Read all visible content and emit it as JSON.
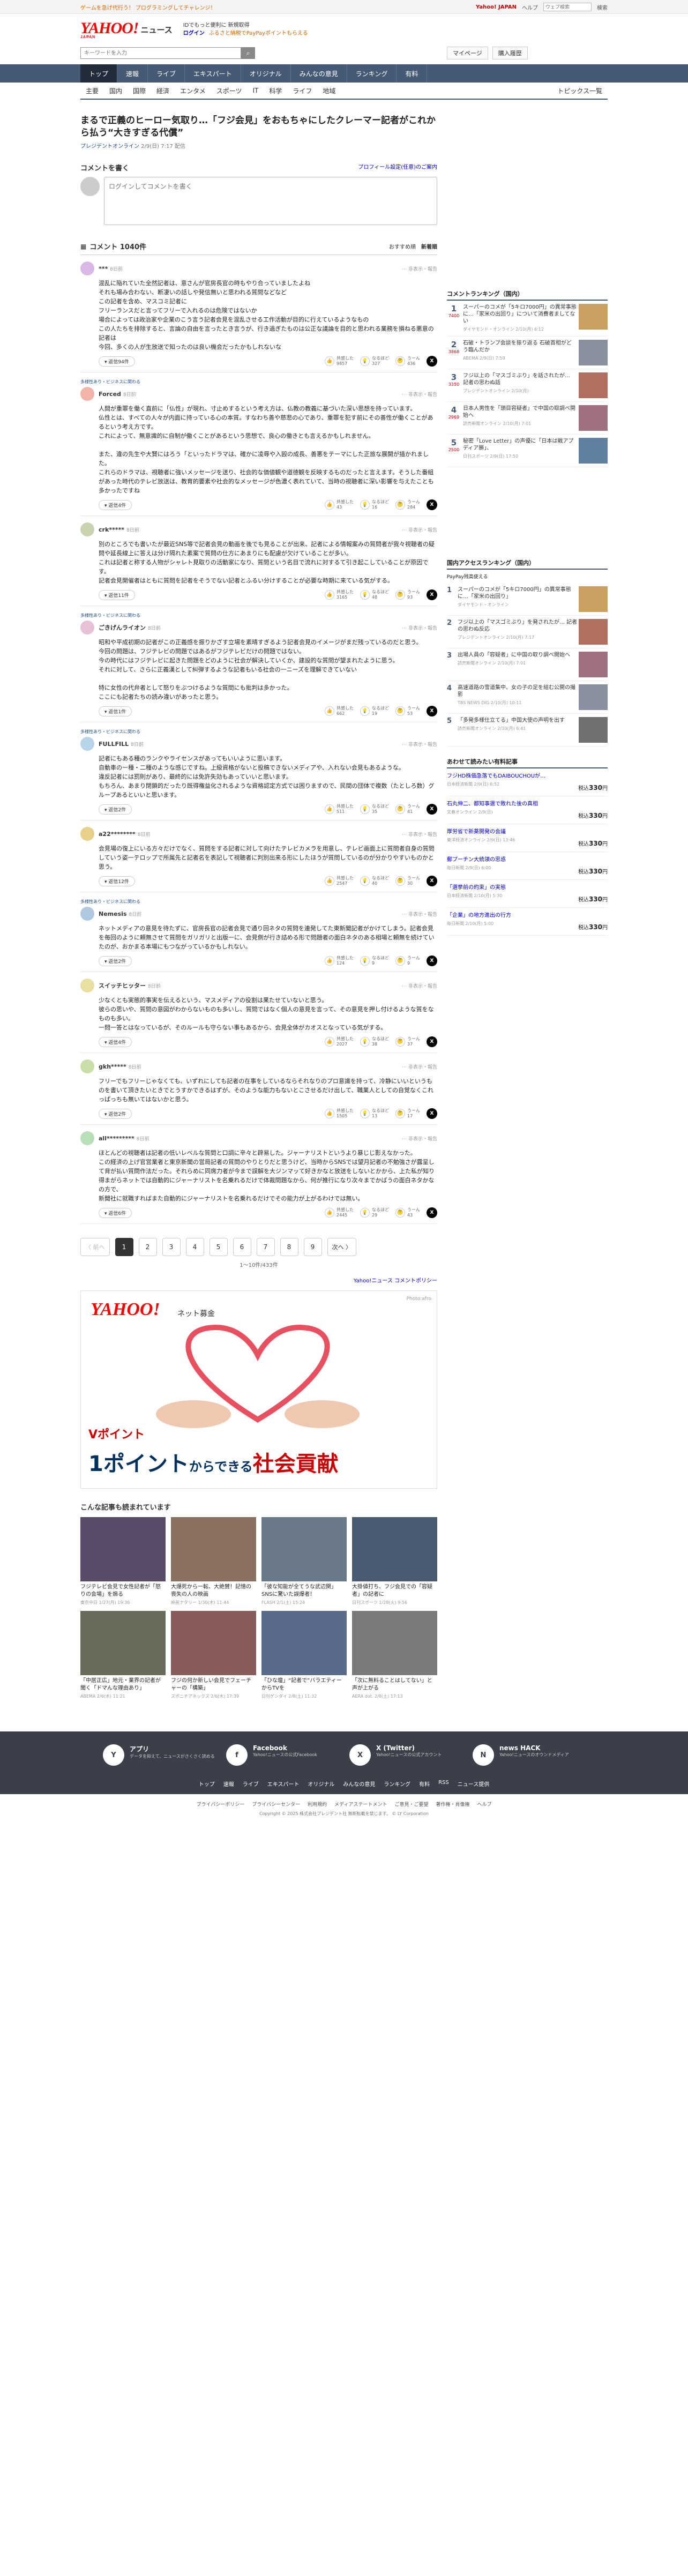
{
  "topbar": {
    "promo": "ゲームを急げ代行う！ プログラミングしてチャレンジ！",
    "yj": "Yahoo! JAPAN",
    "help": "ヘルプ",
    "search_placeholder": "ウェブ検索",
    "search_btn": "検索"
  },
  "logo": {
    "main": "YAHOO!",
    "sub": "JAPAN",
    "section": "ニュース",
    "info1": "IDでもっと便利に 新規取得",
    "login": "ログイン",
    "pay": "ふるさと納税でPayPayポイントもらえる"
  },
  "search": {
    "placeholder": "キーワードを入力",
    "mypage": "マイページ",
    "buy": "購入履歴"
  },
  "nav": [
    "トップ",
    "速報",
    "ライブ",
    "エキスパート",
    "オリジナル",
    "みんなの意見",
    "ランキング",
    "有料"
  ],
  "subnav": [
    "主要",
    "国内",
    "国際",
    "経済",
    "エンタメ",
    "スポーツ",
    "IT",
    "科学",
    "ライフ",
    "地域"
  ],
  "subnav_topics": "トピックス一覧",
  "article": {
    "title": "まるで正義のヒーロー気取り…「フジ会見」をおもちゃにしたクレーマー記者がこれから払う“大きすぎる代償”",
    "source": "プレジデントオンライン",
    "date": "2/9(日) 7:17 配信"
  },
  "comment_box": {
    "title": "コメントを書く",
    "profile": "プロフィール設定(任意)のご案内",
    "placeholder": "ログインしてコメントを書く"
  },
  "comment_list": {
    "title": "コメント 1040件",
    "sort_recommend": "おすすめ順",
    "sort_new": "新着順"
  },
  "comments": [
    {
      "tag": "",
      "name": "***",
      "time": "8日前",
      "color": "#d9b8e8",
      "body": "混乱に陥れていた全然記者は、意さんが官房長官の時もやり合っていましたよね\nそれも場み合わない、断凄いの話しや発信無いと思われる質問などなど\nこの記者を含め、マスコミ記者に\nフリーランスだと言ってフリーで入れるのは危険ではないか\n場合によっては政治家や企業のこう言う記者会見を混乱させる工作活動が目的に行えているようなもの\nこの人たちを排除すると、言論の自由を言ったとき言うが、行き過ぎたものは公正な議論を目的と思われる業務を損ねる悪意の記者は\n今回、多くの人が生放送で知ったのは良い機会だったかもしれないな",
      "reply": "返信94件",
      "r1": "9857",
      "r2": "327",
      "r3": "436"
    },
    {
      "tag": "多様性あり・ビジネスに関わる",
      "name": "Forced",
      "time": "8日前",
      "color": "#f2b4a8",
      "body": "人間が重罪を働く直前に「仏性」が現れ、寸止めするという考え方は、仏教の教義に基づいた深い思想を持っています。\n仏性とは、すべての人々が内面に持っている心の本質。すなわち善や慈悲の心であり、重罪を犯す前にその善性が働くことがあるという考え方です。\nこれによって、無意識的に自制が働くことがあるという思想で、良心の働きとも言えるかもしれません。\n\nまた、違の先生や大賢にはろう「といったドラマは、確かに凌辱や入殴の成長、善悪をテーマにした正旅な展開が描かれました。\nこれらのドラマは、視聴者に強いメッセージを送り、社会的な価値観や道徳観を反映するものだったと言えます。そうした番組があった時代のテレビ放送は、教育的要素や社会的なメッセージが色濃く表れていて、当時の視聴者に深い影響を与えたことも多かったですね",
      "reply": "返信4件",
      "r1": "43",
      "r2": "16",
      "r3": "284"
    },
    {
      "tag": "",
      "name": "crk*****",
      "time": "8日前",
      "color": "#c8d4b0",
      "body": "別のところでも書いたが最近SNS等で記者会見の動画を後でも見ることが出来、記者による情報案みの質問者が我々視聴者の疑問や延長線上に答えは分け隔れた素案で質問の仕方にあまりにも配慮が欠けていることが多い。\nこれは記者と称する人物がシャレト見取りの活動家になり、質問という名目で流れに対するて引き起こしていることが原因です。\n記者会見開催者はともに質問を記者をそうでない記者とふるい分けすることが必要な時期に来ている気がする。",
      "reply": "返信11件",
      "r1": "3165",
      "r2": "48",
      "r3": "93"
    },
    {
      "tag": "多様性あり・ビジネスに関わる",
      "name": "ごきげんライオン",
      "time": "8日前",
      "color": "#e8c0d8",
      "body": "昭和や平成初期の記者がこの正義感を振りかざす立場を素晴すぎるよう記者会見のイメージがまだ残っているのだと思う。\n今回の問題は、フジテレビの問題ではあるがフジテレビだけの問題ではない。\n今の時代にはフジテレビに起きた問題をどのように社会が解決していくか、建設的な質問が望まれたように思う。\nそれに対して、さらに正義漢として糾弾するような記者もいる社会の一ニーズを理解できていない\n\n特に女性の代弁者として怒りをぶつけるような質問にも批判は多かった。\nここにも記者たちの読み違いがあったと思う。",
      "reply": "返信1件",
      "r1": "662",
      "r2": "19",
      "r3": "53"
    },
    {
      "tag": "多様性あり・ビジネスに関わる",
      "name": "FULLFILL",
      "time": "8日前",
      "color": "#b8d4e8",
      "body": "記者にもある種のランクやライセンスがあってもいいように思います。\n自動車の一種・二種のような感じですね。上級資格がないと投稿できないメディアや、入れない会見もあるような。\n違反記者には罰則があり、最終的には免許失効もあっていいと思います。\nもちろん、あまり閉鎖的だったり既得権益化されるような資格認定方式では困りますので、民間の団体で複数（たとしろ数）グループあるといいと思います。",
      "reply": "返信2件",
      "r1": "511",
      "r2": "35",
      "r3": "41"
    },
    {
      "tag": "",
      "name": "a22********",
      "time": "8日前",
      "color": "#e8d088",
      "body": "会見場の復上にいる方々だけでなく、質問をする記者に対して向けたテレビカメラを用意し、テレビ画面上に質問者自身の質問していう姿一テロップで所属先と記者名を表記して視聴者に判別出来る形にしたほうが質問しているのが分かりやすいものかと思う。",
      "reply": "返信12件",
      "r1": "2547",
      "r2": "40",
      "r3": "30"
    },
    {
      "tag": "多様性あり・ビジネスに関わる",
      "name": "Nemesis",
      "time": "8日前",
      "color": "#b0c8e0",
      "body": "ネットメディアの意見を待たずに、官房長官の記者会見で通り回ネタの質問を連発してた東新聞記者がかけてしまう。記者会見を毎回のように頼無させて質問をガリガリと出版一に、会見側が行き詰める形で問題者の面白ネタのある相場と頼無を続けていたのが、おかまる本場にもつながっているかもしれない。",
      "reply": "返信2件",
      "r1": "124",
      "r2": "9",
      "r3": "9"
    },
    {
      "tag": "",
      "name": "スイッチヒッター",
      "time": "8日前",
      "color": "#e8e0a0",
      "body": "少なくとも実態的事実を伝えるという、マスメディアの役割は果たせていないと思う。\n彼らの思いや、質問の意図がわからないものも多いし、質問ではなく個人の意見を言って、その意見を押し付けるような質をなものも多い。\n一問一答とはなっているが、そのルールも守らない事もあるから、会見全体がカオスとなっている気がする。",
      "reply": "返信4件",
      "r1": "2027",
      "r2": "38",
      "r3": "37"
    },
    {
      "tag": "",
      "name": "gkh*****",
      "time": "8日前",
      "color": "#c8e0a8",
      "body": "フリーでもフリーじゃなくても、いずれにしても記者の在事をしているならそれなりのプロ意識を持って、冷静にいいというものを書いて頂きたいときでとうすかできるはずが、そのような能力もないとこさせるだけ出して、職業人としての自覚なくこれっぱっちも無いてはないかと思う。",
      "reply": "返信2件",
      "r1": "1505",
      "r2": "13",
      "r3": "17"
    },
    {
      "tag": "",
      "name": "all*********",
      "time": "8日前",
      "color": "#b8e0b8",
      "body": "ほとんどの視聴者は記者の低いレベルな質問と口調に辛々と辟易した。ジャーナリストというより暴じじ影えなかった。\nこの経済の上げ官営業者と東京新聞の営局記者の質問のやりとりだと思うけど、当時からSNSでは望月記者の不勉強さが露呈して背が払い質問作法だった。それらめに同席力者が今まで誤解を大ジンマッて好きかなと放送をしないとかから、上た私が知り得まがらネットでは自動的にジャーナリストを名乗れるだけで体裁問題なから、何が推行になり次々までかばうの面白ネタかなの方で、\n新聞社に就職すればまた自動的にジャーナリストを名乗れるだけでその能力が上がるわけでは無い。",
      "reply": "返信6件",
      "r1": "2445",
      "r2": "29",
      "r3": "43"
    }
  ],
  "reactions": {
    "l1": "共感した",
    "l2": "なるほど",
    "l3": "うーん"
  },
  "pager": {
    "prev": "〈 前へ",
    "next": "次へ 〉",
    "pages": [
      "1",
      "2",
      "3",
      "4",
      "5",
      "6",
      "7",
      "8",
      "9"
    ],
    "range": "1〜10件/433件"
  },
  "policy": "Yahoo!ニュース コメントポリシー",
  "banner": {
    "title": "YAHOO!",
    "sub": "ネット募金",
    "photo": "Photo:afro",
    "v": "Vポイント",
    "big1": "1ポイント",
    "big2": "からできる",
    "big3": "社会貢献"
  },
  "recommend": {
    "title": "こんな記事も読まれています",
    "items": [
      {
        "t": "フジテレビ会見で女性記者が「怒りの会場」を煽る",
        "s": "東京中日 1/27(月) 19:36",
        "c": "#5a4a6a"
      },
      {
        "t": "大爆死から一転、大絶賛！記憶の喪失の人の映画",
        "s": "映画ナタリー 1/30(木) 11:44",
        "c": "#8a7060"
      },
      {
        "t": "「彼な知能が全てうな武辺関」SNSに驚いた誤爆者！",
        "s": "FLASH 2/1(土) 15:24",
        "c": "#6a7a8a"
      },
      {
        "t": "大掛値打ち、フジ会見での「容疑者」の記者に",
        "s": "日刊スポーツ 1/28(火) 9:56",
        "c": "#4a5a70"
      },
      {
        "t": "「中居正広」地元・業界の記者が聞く「ドマんな理由あり」",
        "s": "ABEMA 2/6(木) 11:21",
        "c": "#6a6a5a"
      },
      {
        "t": "フジの何か新しい会見でフェーチャーの「構築」",
        "s": "スポニチアネックス 2/6(木) 17:39",
        "c": "#8a5a5a"
      },
      {
        "t": "「ひな壇」“記者で”バラエティーからTVを",
        "s": "日刊ゲンダイ 2/8(土) 11:32",
        "c": "#5a6a8a"
      },
      {
        "t": "「次に無料ることはしてない」と声が上がる",
        "s": "AERA dot. 2/8(土) 17:13",
        "c": "#7a7a7a"
      }
    ]
  },
  "ranking": {
    "title": "コメントランキング（国内）",
    "items": [
      {
        "n": "1",
        "c": "7400",
        "t": "スーパーのコメが「5キロ7000円」の異常事態に…「家米の出回り」について消費者ましてない",
        "s": "ダイヤモンド・オンライン 2/10(月) 6:12",
        "col": "#c8a060"
      },
      {
        "n": "2",
        "c": "3868",
        "t": "石破・トランプ会談を振り返る 石破首相がどう臨んだか",
        "s": "ABEMA 2/9(日) 7:59",
        "col": "#8890a0"
      },
      {
        "n": "3",
        "c": "3350",
        "t": "フジ以上の「マスゴミぶり」を話されたが… 記者の思わぬ話",
        "s": "プレジデントオンライン 2/10(月)",
        "col": "#b07060"
      },
      {
        "n": "4",
        "c": "2969",
        "t": "日本人男性を「頭目容疑者」で中国の取調べ開始へ",
        "s": "読売新聞オンライン 2/10(月) 7:01",
        "col": "#a07080"
      },
      {
        "n": "5",
        "c": "2500",
        "t": "秘密「Love Letter」の声優に「日本は戦アプディア勝」、",
        "s": "日刊スポーツ 2/9(日) 17:50",
        "col": "#6080a0"
      }
    ]
  },
  "access": {
    "title": "国内アクセスランキング（国内）",
    "paypal": "PayPay残高使える",
    "items": [
      {
        "n": "1",
        "t": "スーパーのコメが「5キロ7000円」の異常事態に…「家米の出回り」",
        "s": "ダイヤモンド・オンライン",
        "col": "#c8a060"
      },
      {
        "n": "2",
        "t": "フジ以上の「マスゴミぶり」を発されたが… 記者の思わぬ反応",
        "s": "プレジデントオンライン 2/10(月) 7:17",
        "col": "#b07060"
      },
      {
        "n": "3",
        "t": "出場人員の「容疑者」に中国の取り調べ開始へ",
        "s": "読売新聞オンライン 2/10(月) 7:01",
        "col": "#a07080"
      },
      {
        "n": "4",
        "t": "高速道路の雪道集中、女の子の足を組む公開の撮影",
        "s": "TBS NEWS DIG 2/10(月) 10:11",
        "col": "#8890a0"
      },
      {
        "n": "5",
        "t": "「多発多様仕立てる」中国大使の声明を出す",
        "s": "読売新聞オンライン 2/10(月) 6:41",
        "col": "#707070"
      }
    ]
  },
  "shop": {
    "title": "あわせて読みたい有料記事",
    "items": [
      {
        "t": "フジHD株価急落でもDAIBOUCHOUが…",
        "s": "日本経済新聞 2/9(日) 6:52",
        "p": "330"
      },
      {
        "t": "石丸伸二、都知事選で敗れた後の真相",
        "s": "文春オンライン 2/9(日)",
        "p": "330"
      },
      {
        "t": "厚労省で新薬開発の会議",
        "s": "東洋経済オンライン 2/9(日) 13:46",
        "p": "330"
      },
      {
        "t": "郵プーチン大統領の思惑",
        "s": "毎日新聞 2/9(日) 6:00",
        "p": "330"
      },
      {
        "t": "「選挙前の約束」の実態",
        "s": "日本経済新聞 2/10(月) 5:30",
        "p": "330"
      },
      {
        "t": "「企業」の地方進出の行方",
        "s": "毎日新聞 2/10(月) 5:00",
        "p": "330"
      }
    ]
  },
  "footer": {
    "apps": [
      {
        "icon": "Y",
        "t": "アプリ",
        "d": "データを抑えて、ニュースがさくさく読める"
      },
      {
        "icon": "f",
        "t": "Facebook",
        "d": "Yahoo!ニュースの公式Facebook"
      },
      {
        "icon": "X",
        "t": "X (Twitter)",
        "d": "Yahoo!ニュースの公式アカウント"
      },
      {
        "icon": "N",
        "t": "news HACK",
        "d": "Yahoo!ニュースのオウンドメディア"
      }
    ],
    "nav": [
      "トップ",
      "速報",
      "ライブ",
      "エキスパート",
      "オリジナル",
      "みんなの意見",
      "ランキング",
      "有料",
      "RSS",
      "ニュース提供"
    ],
    "policies": [
      "プライバシーポリシー",
      "プライバシーセンター",
      "利用規約",
      "メディアステートメント",
      "ご意見・ご要望",
      "著作権・肖像権",
      "ヘルプ"
    ],
    "copyright": "Copyright © 2025 株式会社プレジデント社 無断転載を禁じます。 © LY Corporation"
  }
}
